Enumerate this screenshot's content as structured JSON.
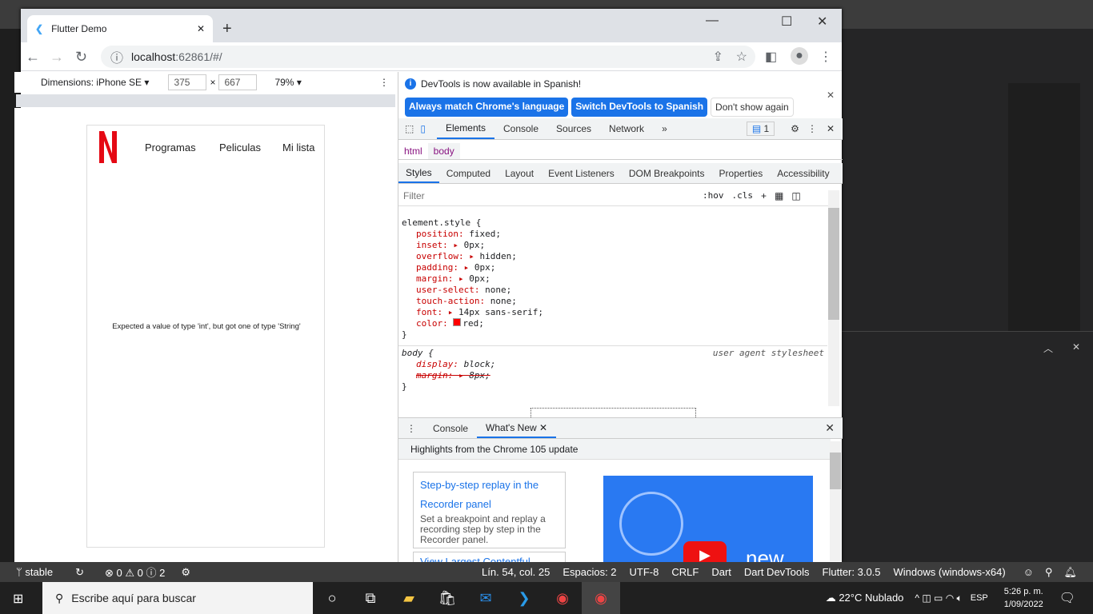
{
  "browser": {
    "tab_title": "Flutter Demo",
    "url_host": "localhost",
    "url_rest": ":62861/#/"
  },
  "device_toolbar": {
    "dimensions": "Dimensions: iPhone SE",
    "width": "375",
    "height": "667",
    "times": "×",
    "zoom": "79%"
  },
  "app": {
    "nav": [
      "Programas",
      "Peliculas",
      "Mi lista"
    ],
    "error": "Expected a value of type 'int', but got one of type 'String'",
    "logo_color": "#e50914"
  },
  "devtools": {
    "infobar": {
      "message": "DevTools is now available in Spanish!",
      "btn1": "Always match Chrome's language",
      "btn2": "Switch DevTools to Spanish",
      "btn3": "Don't show again"
    },
    "tabs": [
      "Elements",
      "Console",
      "Sources",
      "Network"
    ],
    "issues_count": "1",
    "breadcrumbs": [
      "html",
      "body"
    ],
    "subtabs": [
      "Styles",
      "Computed",
      "Layout",
      "Event Listeners",
      "DOM Breakpoints",
      "Properties",
      "Accessibility"
    ],
    "filter_placeholder": "Filter",
    "hov": ":hov",
    "cls": ".cls",
    "element_style": {
      "selector": "element.style {",
      "props": [
        [
          "position",
          "fixed;"
        ],
        [
          "inset",
          "0px;"
        ],
        [
          "overflow",
          "hidden;"
        ],
        [
          "padding",
          "0px;"
        ],
        [
          "margin",
          "0px;"
        ],
        [
          "user-select",
          "none;"
        ],
        [
          "touch-action",
          "none;"
        ],
        [
          "font",
          "14px sans-serif;"
        ],
        [
          "color",
          "red;"
        ]
      ]
    },
    "body_rule": {
      "selector": "body {",
      "source": "user agent stylesheet",
      "props": [
        [
          "display",
          "block;"
        ],
        [
          "margin",
          "8px;"
        ]
      ]
    },
    "close_brace": "}",
    "drawer_tabs": [
      "Console",
      "What's New"
    ],
    "whatsnew": {
      "header": "Highlights from the Chrome 105 update",
      "card1_title": "Step-by-step replay in the Recorder panel",
      "card1_desc": "Set a breakpoint and replay a recording step by step in the Recorder panel.",
      "card2_title": "View Largest Contentful",
      "video_label": "new"
    }
  },
  "statusbar": {
    "branch": "stable",
    "errors": "0",
    "warnings": "0",
    "infos": "2",
    "items": [
      "Lín. 54, col. 25",
      "Espacios: 2",
      "UTF-8",
      "CRLF",
      "Dart",
      "Dart DevTools",
      "Flutter: 3.0.5",
      "Windows (windows-x64)"
    ]
  },
  "taskbar": {
    "search_placeholder": "Escribe aquí para buscar",
    "weather": "22°C  Nublado",
    "lang": "ESP",
    "time": "5:26 p. m.",
    "date": "1/09/2022"
  }
}
